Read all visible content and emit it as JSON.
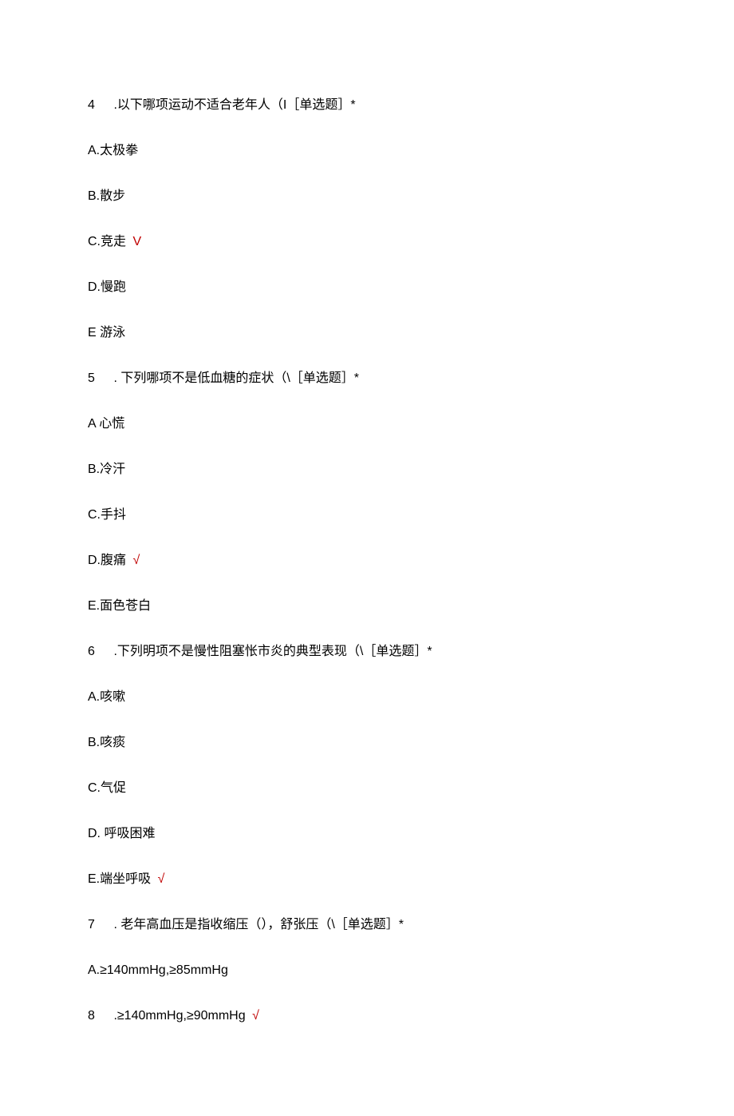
{
  "questions": [
    {
      "number": "4",
      "stem": "  .以下哪项运动不适合老年人（I［单选题］*",
      "options": [
        {
          "label": "A.太极拳",
          "correct": false,
          "mark": ""
        },
        {
          "label": "B.散步",
          "correct": false,
          "mark": ""
        },
        {
          "label": "C.竞走",
          "correct": true,
          "mark": " V"
        },
        {
          "label": "D.慢跑",
          "correct": false,
          "mark": ""
        },
        {
          "label": "E 游泳",
          "correct": false,
          "mark": ""
        }
      ]
    },
    {
      "number": "5",
      "stem": "  . 下列哪项不是低血糖的症状（\\［单选题］*",
      "options": [
        {
          "label": "A 心慌",
          "correct": false,
          "mark": ""
        },
        {
          "label": "B.冷汗",
          "correct": false,
          "mark": ""
        },
        {
          "label": "C.手抖",
          "correct": false,
          "mark": ""
        },
        {
          "label": "D.腹痛",
          "correct": true,
          "mark": " √"
        },
        {
          "label": "E.面色苍白",
          "correct": false,
          "mark": ""
        }
      ]
    },
    {
      "number": "6",
      "stem": "  .下列明项不是慢性阻塞怅市炎的典型表现（\\［单选题］*",
      "options": [
        {
          "label": "A.咳嗽",
          "correct": false,
          "mark": ""
        },
        {
          "label": "B.咳痰",
          "correct": false,
          "mark": ""
        },
        {
          "label": "C.气促",
          "correct": false,
          "mark": ""
        },
        {
          "label": "D. 呼吸困难",
          "correct": false,
          "mark": ""
        },
        {
          "label": "E.端坐呼吸",
          "correct": true,
          "mark": " √"
        }
      ]
    },
    {
      "number": "7",
      "stem": "  . 老年高血压是指收缩压（），舒张压（\\［单选题］*",
      "options": [
        {
          "label": "A.≥140mmHg,≥85mmHg",
          "correct": false,
          "mark": ""
        }
      ]
    },
    {
      "number": "8",
      "stem": "  .≥140mmHg,≥90mmHg",
      "stem_correct": true,
      "stem_mark": "√",
      "options": []
    }
  ]
}
